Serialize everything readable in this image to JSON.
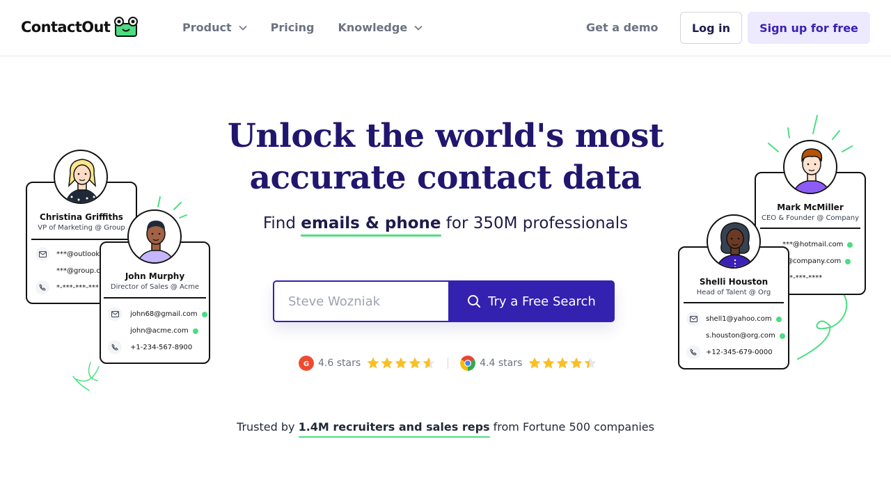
{
  "brand": {
    "name": "ContactOut"
  },
  "nav": {
    "items": [
      {
        "label": "Product",
        "dropdown": true
      },
      {
        "label": "Pricing",
        "dropdown": false
      },
      {
        "label": "Knowledge",
        "dropdown": true
      }
    ],
    "demo": "Get a demo",
    "login": "Log in",
    "signup": "Sign up for free"
  },
  "hero": {
    "headline_line1": "Unlock the world's most",
    "headline_line2": "accurate contact data",
    "sub_prefix": "Find ",
    "sub_bold": "emails & phone",
    "sub_suffix": " for 350M professionals",
    "search_placeholder": "Steve Wozniak",
    "search_button": "Try a Free Search"
  },
  "ratings": [
    {
      "source_icon": "g2-icon",
      "label": "4.6 stars",
      "stars": 4.6
    },
    {
      "source_icon": "chrome-icon",
      "label": "4.4 stars",
      "stars": 4.4
    }
  ],
  "trusted": {
    "prefix": "Trusted by ",
    "bold": "1.4M recruiters and sales reps",
    "suffix": " from Fortune 500 companies"
  },
  "cards": {
    "christina": {
      "name": "Christina Griffiths",
      "title": "VP of Marketing @ Group",
      "email1": "***@outlook.",
      "email2": "***@group.co",
      "phone": "*-***-***-***"
    },
    "john": {
      "name": "John Murphy",
      "title": "Director of Sales @ Acme",
      "email1": "john68@gmail.com",
      "email2": "john@acme.com",
      "phone": "+1-234-567-8900"
    },
    "mark": {
      "name": "Mark McMiller",
      "title": "CEO & Founder @ Company",
      "email1": "***@hotmail.com",
      "email2": "*@company.com",
      "phone": "***-***-****"
    },
    "shelli": {
      "name": "Shelli Houston",
      "title": "Head of Talent @ Org",
      "email1": "shell1@yahoo.com",
      "email2": "s.houston@org.com",
      "phone": "+12-345-679-0000"
    }
  },
  "colors": {
    "brand_navy": "#21166e",
    "primary": "#3321b0",
    "accent_green": "#4ade80",
    "signup_bg": "#ede9fe",
    "star": "#fbbf24"
  }
}
